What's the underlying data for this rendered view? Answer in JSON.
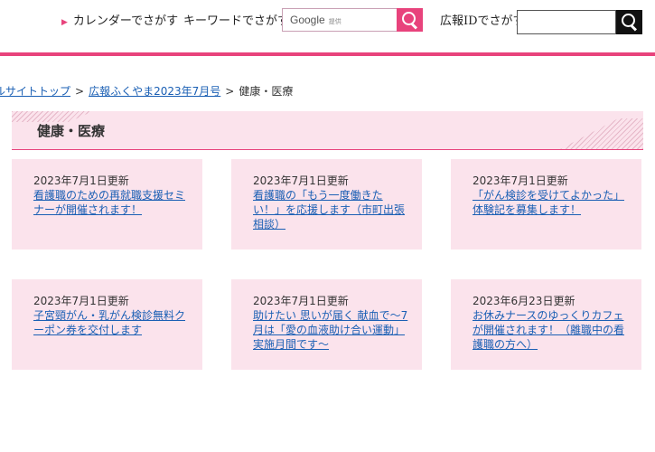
{
  "header": {
    "calendar_link": "カレンダーでさがす",
    "keyword_label": "キーワードでさがす",
    "google_label": "Google",
    "google_sub": "提供",
    "id_label": "広報IDでさがす",
    "id_input_value": ""
  },
  "breadcrumb": {
    "items": [
      "ルサイトトップ",
      "広報ふくやま2023年7月号"
    ],
    "separator": ">",
    "current": "健康・医療"
  },
  "page_title": "健康・医療",
  "cards": [
    {
      "date": "2023年7月1日更新",
      "title": "看護職のための再就職支援セミナーが開催されます！"
    },
    {
      "date": "2023年7月1日更新",
      "title": "看護職の「もう一度働きたい！」を応援します（市町出張相談）"
    },
    {
      "date": "2023年7月1日更新",
      "title": "「がん検診を受けてよかった」体験記を募集します！"
    },
    {
      "date": "2023年7月1日更新",
      "title": "子宮頸がん・乳がん検診無料クーポン券を交付します"
    },
    {
      "date": "2023年7月1日更新",
      "title": "助けたい 思いが届く 献血で〜7月は「愛の血液助け合い運動」実施月間です〜"
    },
    {
      "date": "2023年6月23日更新",
      "title": "お休みナースのゆっくりカフェが開催されます！（離職中の看護職の方へ）"
    }
  ],
  "colors": {
    "accent": "#e8437c",
    "card_bg": "#fbe3ec",
    "link": "#1a5fb4"
  }
}
